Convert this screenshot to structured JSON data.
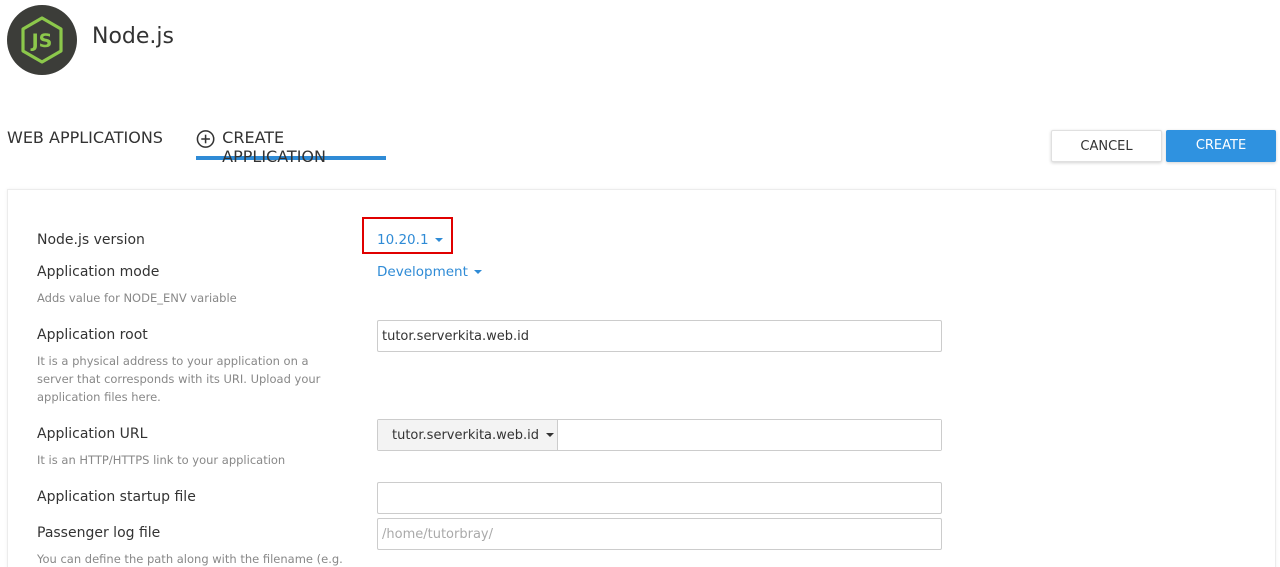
{
  "header": {
    "app_name": "Node.js",
    "logo_icon": "nodejs-logo-icon"
  },
  "tabs": {
    "web_applications": "WEB APPLICATIONS",
    "create_application": "CREATE APPLICATION"
  },
  "actions": {
    "cancel_label": "CANCEL",
    "create_label": "CREATE"
  },
  "form": {
    "nodejs_version": {
      "label": "Node.js version",
      "value": "10.20.1"
    },
    "app_mode": {
      "label": "Application mode",
      "value": "Development",
      "hint": "Adds value for NODE_ENV variable"
    },
    "app_root": {
      "label": "Application root",
      "value": "tutor.serverkita.web.id",
      "hint": "It is a physical address to your application on a server that corresponds with its URI. Upload your application files here."
    },
    "app_url": {
      "label": "Application URL",
      "domain": "tutor.serverkita.web.id",
      "path": "",
      "hint": "It is an HTTP/HTTPS link to your application"
    },
    "startup_file": {
      "label": "Application startup file",
      "value": ""
    },
    "log_file": {
      "label": "Passenger log file",
      "placeholder": "/home/tutorbray/",
      "hint": "You can define the path along with the filename (e.g."
    }
  },
  "colors": {
    "accent": "#2f8bd6",
    "create_button": "#2f92e0",
    "highlight": "#e00000",
    "logo_bg": "#3c3d39",
    "logo_green": "#8cc84b"
  }
}
